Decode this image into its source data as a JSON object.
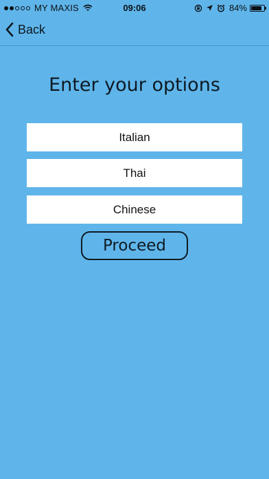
{
  "status_bar": {
    "carrier": "MY MAXIS",
    "time": "09:06",
    "battery_percent": "84%",
    "battery_level": 0.84,
    "signal_bars_filled": 2,
    "signal_bars_total": 5,
    "icons": [
      "wifi-icon",
      "screen-rotation-lock-icon",
      "location-arrow-icon",
      "alarm-icon",
      "battery-icon"
    ]
  },
  "nav": {
    "back_label": "Back",
    "back_icon": "chevron-left-icon"
  },
  "main": {
    "title": "Enter your options",
    "options": [
      {
        "value": "Italian"
      },
      {
        "value": "Thai"
      },
      {
        "value": "Chinese"
      }
    ],
    "proceed_label": "Proceed"
  },
  "colors": {
    "background": "#5fb5ea",
    "input_background": "#ffffff",
    "text": "#0f1a23"
  }
}
